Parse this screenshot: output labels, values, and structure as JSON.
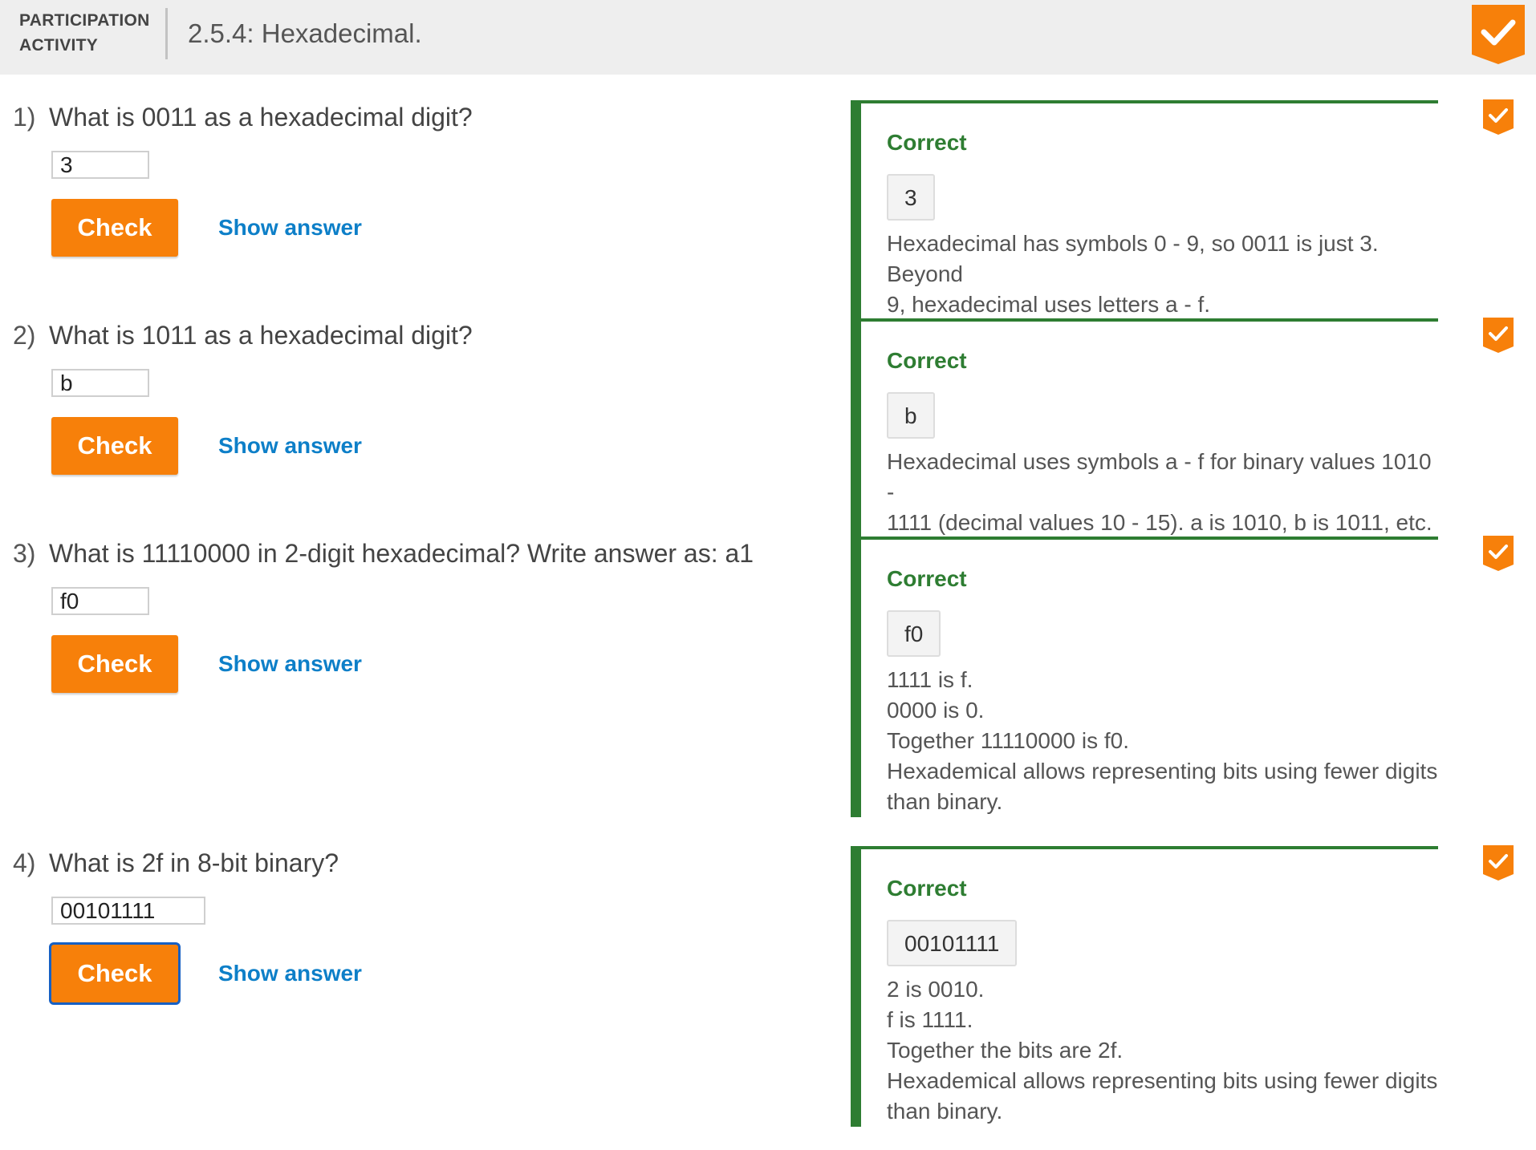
{
  "header": {
    "activity_type_line1": "PARTICIPATION",
    "activity_type_line2": "ACTIVITY",
    "title": "2.5.4: Hexadecimal.",
    "badge_icon": "checkmark-badge-icon",
    "accent_color": "#f7800a"
  },
  "questions": [
    {
      "number": "1)",
      "prompt": "What is 0011 as a hexadecimal digit?",
      "answer_value": "3",
      "check_label": "Check",
      "show_answer_label": "Show answer",
      "feedback": {
        "status": "Correct",
        "answer": "3",
        "lines": [
          "Hexadecimal has symbols 0 - 9, so 0011 is just 3. Beyond",
          "9, hexadecimal uses letters a - f."
        ]
      },
      "completed": true
    },
    {
      "number": "2)",
      "prompt": "What is 1011 as a hexadecimal digit?",
      "answer_value": "b",
      "check_label": "Check",
      "show_answer_label": "Show answer",
      "feedback": {
        "status": "Correct",
        "answer": "b",
        "lines": [
          "Hexadecimal uses symbols a - f for binary values 1010 -",
          "1111 (decimal values 10 - 15). a is 1010, b is 1011, etc."
        ]
      },
      "completed": true
    },
    {
      "number": "3)",
      "prompt": "What is 11110000 in 2-digit hexadecimal? Write answer as: a1",
      "answer_value": "f0",
      "check_label": "Check",
      "show_answer_label": "Show answer",
      "feedback": {
        "status": "Correct",
        "answer": "f0",
        "lines": [
          "1111 is f.",
          "0000 is 0.",
          "Together 11110000 is f0.",
          "Hexademical allows representing bits using fewer digits",
          "than binary."
        ]
      },
      "completed": true
    },
    {
      "number": "4)",
      "prompt": "What is 2f in 8-bit binary?",
      "answer_value": "00101111",
      "check_label": "Check",
      "show_answer_label": "Show answer",
      "feedback": {
        "status": "Correct",
        "answer": "00101111",
        "lines": [
          "2 is 0010.",
          "f is 1111.",
          "Together the bits are 2f.",
          "Hexademical allows representing bits using fewer digits",
          "than binary."
        ]
      },
      "completed": true
    }
  ],
  "colors": {
    "correct_green": "#2e7d32",
    "link_blue": "#0d7fc8",
    "check_orange": "#f7800a"
  }
}
